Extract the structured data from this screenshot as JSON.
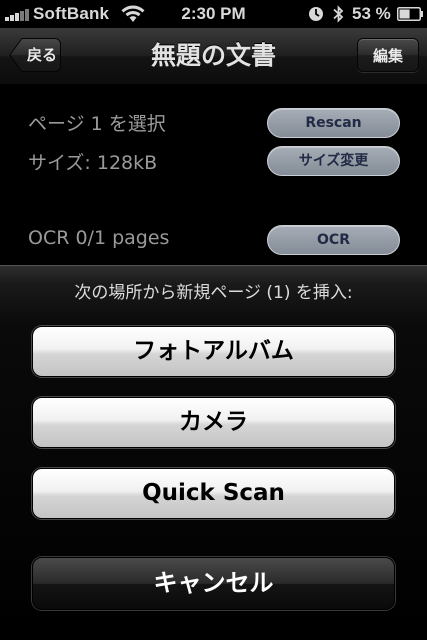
{
  "status_bar": {
    "carrier": "SoftBank",
    "time": "2:30 PM",
    "battery_percent": "53 %",
    "battery_level": 0.53
  },
  "nav": {
    "back_label": "戻る",
    "title": "無題の文書",
    "edit_label": "編集"
  },
  "info": {
    "page_select": "ページ 1 を選択",
    "size": "サイズ: 128kB",
    "ocr_status": "OCR 0/1 pages",
    "rescan_label": "Rescan",
    "resize_label": "サイズ変更",
    "ocr_label": "OCR"
  },
  "action_sheet": {
    "title": "次の場所から新規ページ (1) を挿入:",
    "photo_album_label": "フォトアルバム",
    "camera_label": "カメラ",
    "quick_scan_label": "Quick Scan",
    "cancel_label": "キャンセル"
  }
}
